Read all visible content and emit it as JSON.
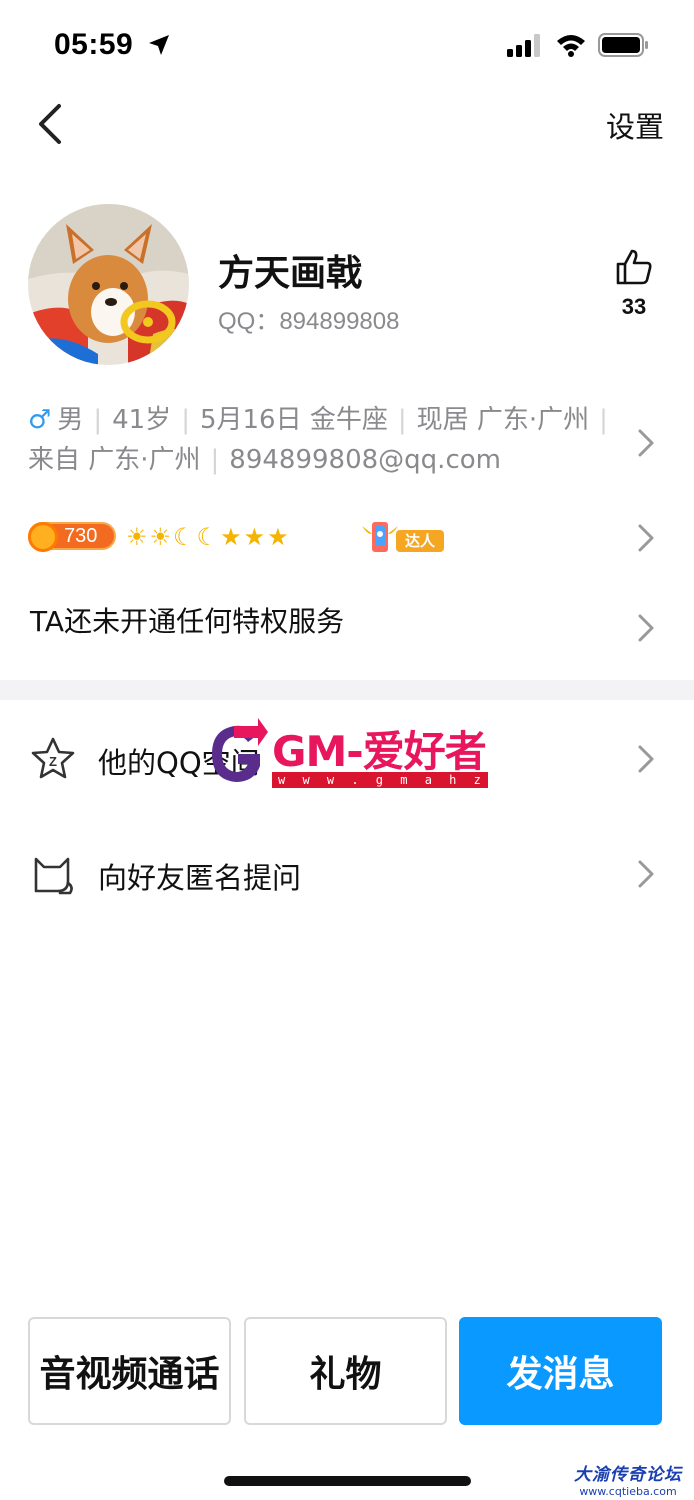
{
  "status_bar": {
    "time": "05:59",
    "icons": [
      "location-arrow-icon",
      "signal-icon",
      "wifi-icon",
      "battery-icon"
    ]
  },
  "nav": {
    "back_icon": "chevron-left-icon",
    "settings_label": "设置"
  },
  "profile": {
    "name": "方天画戟",
    "qq_line": "QQ：894899808",
    "likes": "33",
    "like_icon": "thumbs-up-icon"
  },
  "info": {
    "gender_symbol": "♂",
    "gender": "男",
    "age": "41岁",
    "birthday": "5月16日 金牛座",
    "residence": "现居 广东·广州",
    "hometown": "来自 广东·广州",
    "email": "894899808@qq.com"
  },
  "level": {
    "value": "730",
    "icons": "☀☀☾☾★★★",
    "expert_badge": "达人"
  },
  "privilege": {
    "text": "TA还未开通任何特权服务"
  },
  "list": [
    {
      "label": "他的QQ空间",
      "icon": "star-space-icon"
    },
    {
      "label": "向好友匿名提问",
      "icon": "cat-icon"
    }
  ],
  "watermark": {
    "text": "GM-爱好者",
    "url": "w w w . g m a h z . c o m"
  },
  "actions": {
    "call_label": "音视频通话",
    "gift_label": "礼物",
    "message_label": "发消息"
  },
  "forum_mark": {
    "title": "大渝传奇论坛",
    "url": "www.cqtieba.com"
  },
  "colors": {
    "primary": "#0a99ff",
    "male": "#2f9bf0",
    "watermark_pink": "#e8175d"
  }
}
